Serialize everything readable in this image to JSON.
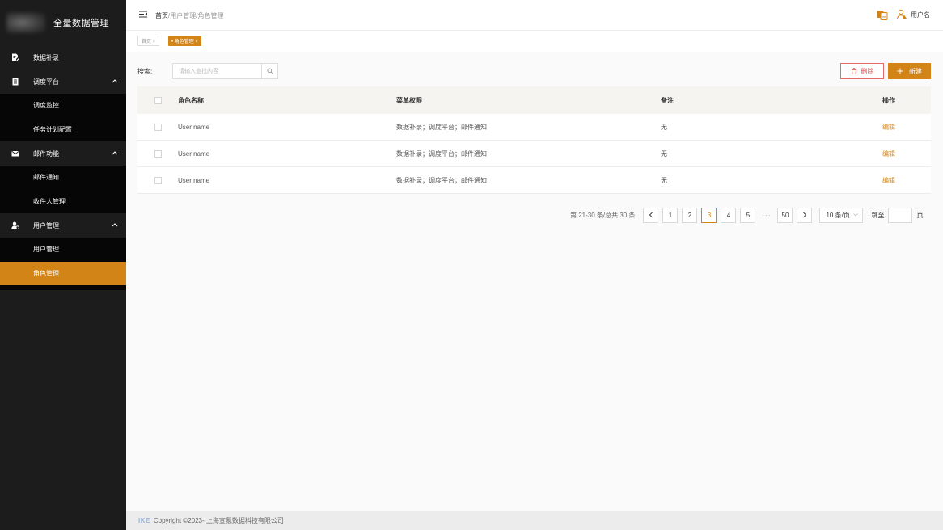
{
  "app": {
    "title": "全量数据管理"
  },
  "sidebar": {
    "items": [
      {
        "label": "数据补录",
        "icon": "document-edit-icon"
      },
      {
        "label": "调度平台",
        "icon": "calendar-list-icon",
        "expanded": true,
        "children": [
          {
            "label": "调度监控"
          },
          {
            "label": "任务计划配置"
          }
        ]
      },
      {
        "label": "邮件功能",
        "icon": "mail-icon",
        "expanded": true,
        "children": [
          {
            "label": "邮件通知"
          },
          {
            "label": "收件人管理"
          }
        ]
      },
      {
        "label": "用户管理",
        "icon": "user-settings-icon",
        "expanded": true,
        "children": [
          {
            "label": "用户管理"
          },
          {
            "label": "角色管理",
            "active": true
          }
        ]
      }
    ]
  },
  "header": {
    "breadcrumb": {
      "home": "首页",
      "rest": "/用户管理/角色管理"
    },
    "username": "用户名"
  },
  "tabs": [
    {
      "label": "首页 ×"
    },
    {
      "label": "• 角色管理 ×",
      "active": true
    }
  ],
  "search": {
    "label": "搜索:",
    "placeholder": "请输入查找内容"
  },
  "actions": {
    "delete": "删除",
    "new": "新建"
  },
  "table": {
    "columns": [
      "角色名称",
      "菜单权限",
      "备注",
      "操作"
    ],
    "rows": [
      {
        "name": "User name",
        "permissions": "数据补录；调度平台；邮件通知",
        "note": "无",
        "action": "编辑"
      },
      {
        "name": "User name",
        "permissions": "数据补录；调度平台；邮件通知",
        "note": "无",
        "action": "编辑"
      },
      {
        "name": "User name",
        "permissions": "数据补录；调度平台；邮件通知",
        "note": "无",
        "action": "编辑"
      }
    ]
  },
  "pagination": {
    "summary": "第 21-30 条/总共 30 条",
    "pages": [
      "1",
      "2",
      "3",
      "4",
      "5"
    ],
    "current": "3",
    "ellipsis": "···",
    "last": "50",
    "page_size": "10 条/页",
    "goto_label": "跳至",
    "goto_unit": "页"
  },
  "footer": {
    "logo": "IKE",
    "copyright": "Copyright ©2023- 上海宣氪数据科技有限公司"
  },
  "colors": {
    "accent": "#d38417",
    "sidebar_bg": "#1c1c1c",
    "danger": "#e04d4d"
  }
}
